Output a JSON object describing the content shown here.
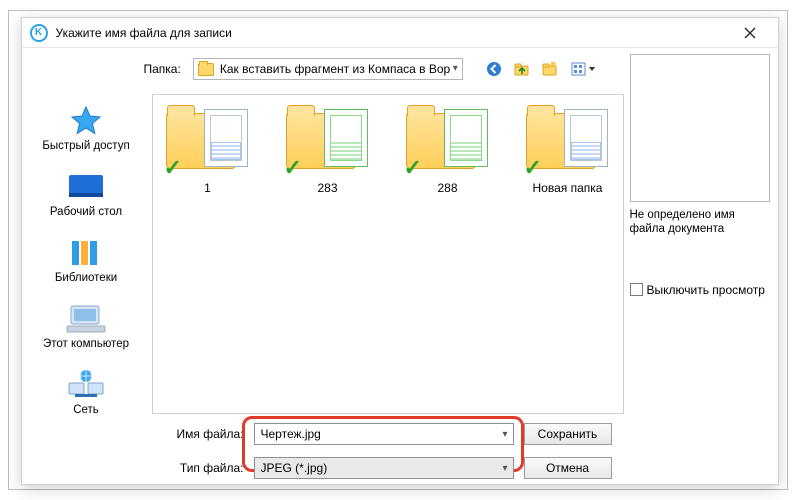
{
  "title": "Укажите имя файла для записи",
  "folder_label": "Папка:",
  "folder_value": "Как вставить фрагмент из Компаса в Вор",
  "toolbar_icons": [
    "back-icon",
    "up-icon",
    "new-folder-icon",
    "views-icon"
  ],
  "places": [
    {
      "key": "quick",
      "label": "Быстрый доступ"
    },
    {
      "key": "desktop",
      "label": "Рабочий стол"
    },
    {
      "key": "libraries",
      "label": "Библиотеки"
    },
    {
      "key": "computer",
      "label": "Этот компьютер"
    },
    {
      "key": "network",
      "label": "Сеть"
    }
  ],
  "files": [
    {
      "name": "1",
      "variant": "blue1"
    },
    {
      "name": "283",
      "variant": "green"
    },
    {
      "name": "288",
      "variant": "green"
    },
    {
      "name": "Новая папка",
      "variant": "blue2"
    }
  ],
  "preview_msg": "Не определено имя файла документа",
  "preview_checkbox": "Выключить просмотр",
  "fields": {
    "filename_label": "Имя файла:",
    "filename_value": "Чертеж.jpg",
    "filetype_label": "Тип файла:",
    "filetype_value": "JPEG (*.jpg)"
  },
  "buttons": {
    "save": "Сохранить",
    "cancel": "Отмена"
  }
}
